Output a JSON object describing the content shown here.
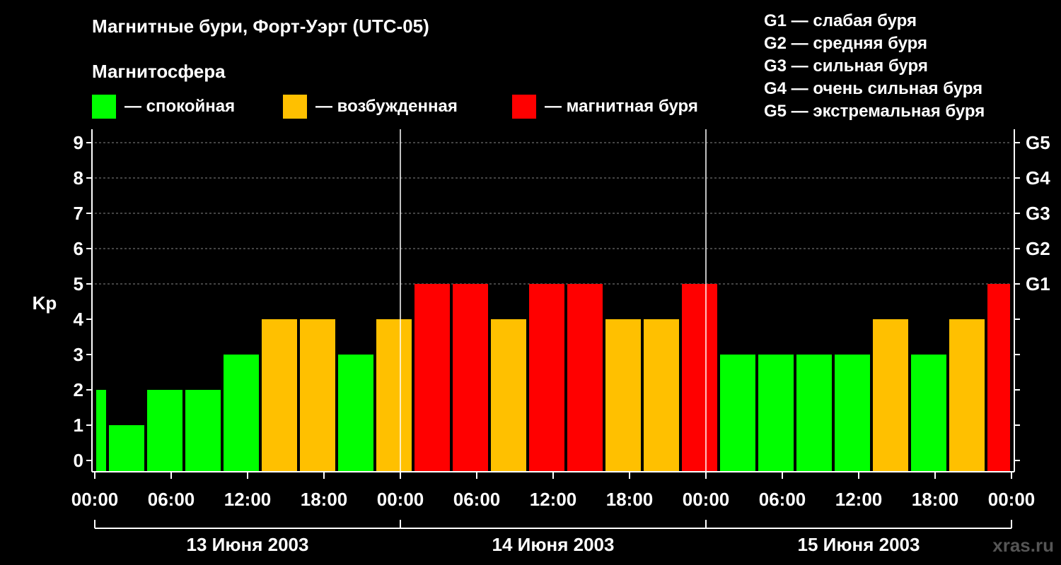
{
  "header": {
    "title": "Магнитные бури, Форт-Уэрт (UTC-05)",
    "legend_heading": "Магнитосфера"
  },
  "legend": [
    {
      "label": "— спокойная",
      "color": "#00ff00"
    },
    {
      "label": "— возбужденная",
      "color": "#ffc000"
    },
    {
      "label": "— магнитная буря",
      "color": "#ff0000"
    }
  ],
  "gscale": [
    "G1 — слабая буря",
    "G2 — средняя буря",
    "G3 — сильная буря",
    "G4 — очень сильная буря",
    "G5 — экстремальная буря"
  ],
  "watermark": "xras.ru",
  "chart_data": {
    "type": "bar",
    "ylabel": "Kp",
    "ylim": [
      0,
      9
    ],
    "y_ticks": [
      "0",
      "1",
      "2",
      "3",
      "4",
      "5",
      "6",
      "7",
      "8",
      "9"
    ],
    "right_ticks": [
      {
        "value": 5,
        "label": "G1"
      },
      {
        "value": 6,
        "label": "G2"
      },
      {
        "value": 7,
        "label": "G3"
      },
      {
        "value": 8,
        "label": "G4"
      },
      {
        "value": 9,
        "label": "G5"
      }
    ],
    "x_tick_labels": [
      "00:00",
      "06:00",
      "12:00",
      "18:00",
      "00:00",
      "06:00",
      "12:00",
      "18:00",
      "00:00",
      "06:00",
      "12:00",
      "18:00",
      "00:00"
    ],
    "days": [
      "13 Июня 2003",
      "14 Июня 2003",
      "15 Июня 2003"
    ],
    "colors": {
      "quiet": "#00ff00",
      "active": "#ffc000",
      "storm": "#ff0000"
    },
    "grid": true,
    "bars": [
      {
        "start_hour": 0,
        "end_hour": 1,
        "kp": 2
      },
      {
        "start_hour": 1,
        "end_hour": 4,
        "kp": 1
      },
      {
        "start_hour": 4,
        "end_hour": 7,
        "kp": 2
      },
      {
        "start_hour": 7,
        "end_hour": 10,
        "kp": 2
      },
      {
        "start_hour": 10,
        "end_hour": 13,
        "kp": 3
      },
      {
        "start_hour": 13,
        "end_hour": 16,
        "kp": 4
      },
      {
        "start_hour": 16,
        "end_hour": 19,
        "kp": 4
      },
      {
        "start_hour": 19,
        "end_hour": 22,
        "kp": 3
      },
      {
        "start_hour": 22,
        "end_hour": 25,
        "kp": 4
      },
      {
        "start_hour": 25,
        "end_hour": 28,
        "kp": 5
      },
      {
        "start_hour": 28,
        "end_hour": 31,
        "kp": 5
      },
      {
        "start_hour": 31,
        "end_hour": 34,
        "kp": 4
      },
      {
        "start_hour": 34,
        "end_hour": 37,
        "kp": 5
      },
      {
        "start_hour": 37,
        "end_hour": 40,
        "kp": 5
      },
      {
        "start_hour": 40,
        "end_hour": 43,
        "kp": 4
      },
      {
        "start_hour": 43,
        "end_hour": 46,
        "kp": 4
      },
      {
        "start_hour": 46,
        "end_hour": 49,
        "kp": 5
      },
      {
        "start_hour": 49,
        "end_hour": 52,
        "kp": 3
      },
      {
        "start_hour": 52,
        "end_hour": 55,
        "kp": 3
      },
      {
        "start_hour": 55,
        "end_hour": 58,
        "kp": 3
      },
      {
        "start_hour": 58,
        "end_hour": 61,
        "kp": 3
      },
      {
        "start_hour": 61,
        "end_hour": 64,
        "kp": 4
      },
      {
        "start_hour": 64,
        "end_hour": 67,
        "kp": 3
      },
      {
        "start_hour": 67,
        "end_hour": 70,
        "kp": 4
      },
      {
        "start_hour": 70,
        "end_hour": 72,
        "kp": 5
      }
    ]
  }
}
